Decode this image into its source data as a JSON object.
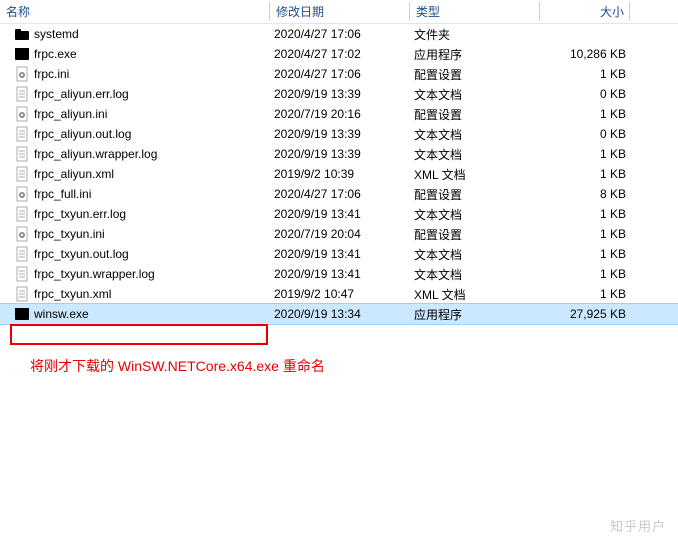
{
  "columns": {
    "name": "名称",
    "date": "修改日期",
    "type": "类型",
    "size": "大小"
  },
  "rows": [
    {
      "icon": "folder",
      "name": "systemd",
      "date": "2020/4/27 17:06",
      "type": "文件夹",
      "size": "",
      "selected": false
    },
    {
      "icon": "exe",
      "name": "frpc.exe",
      "date": "2020/4/27 17:02",
      "type": "应用程序",
      "size": "10,286 KB",
      "selected": false
    },
    {
      "icon": "ini",
      "name": "frpc.ini",
      "date": "2020/4/27 17:06",
      "type": "配置设置",
      "size": "1 KB",
      "selected": false
    },
    {
      "icon": "txt",
      "name": "frpc_aliyun.err.log",
      "date": "2020/9/19 13:39",
      "type": "文本文档",
      "size": "0 KB",
      "selected": false
    },
    {
      "icon": "ini",
      "name": "frpc_aliyun.ini",
      "date": "2020/7/19 20:16",
      "type": "配置设置",
      "size": "1 KB",
      "selected": false
    },
    {
      "icon": "txt",
      "name": "frpc_aliyun.out.log",
      "date": "2020/9/19 13:39",
      "type": "文本文档",
      "size": "0 KB",
      "selected": false
    },
    {
      "icon": "txt",
      "name": "frpc_aliyun.wrapper.log",
      "date": "2020/9/19 13:39",
      "type": "文本文档",
      "size": "1 KB",
      "selected": false
    },
    {
      "icon": "xml",
      "name": "frpc_aliyun.xml",
      "date": "2019/9/2 10:39",
      "type": "XML 文档",
      "size": "1 KB",
      "selected": false
    },
    {
      "icon": "ini",
      "name": "frpc_full.ini",
      "date": "2020/4/27 17:06",
      "type": "配置设置",
      "size": "8 KB",
      "selected": false
    },
    {
      "icon": "txt",
      "name": "frpc_txyun.err.log",
      "date": "2020/9/19 13:41",
      "type": "文本文档",
      "size": "1 KB",
      "selected": false
    },
    {
      "icon": "ini",
      "name": "frpc_txyun.ini",
      "date": "2020/7/19 20:04",
      "type": "配置设置",
      "size": "1 KB",
      "selected": false
    },
    {
      "icon": "txt",
      "name": "frpc_txyun.out.log",
      "date": "2020/9/19 13:41",
      "type": "文本文档",
      "size": "1 KB",
      "selected": false
    },
    {
      "icon": "txt",
      "name": "frpc_txyun.wrapper.log",
      "date": "2020/9/19 13:41",
      "type": "文本文档",
      "size": "1 KB",
      "selected": false
    },
    {
      "icon": "xml",
      "name": "frpc_txyun.xml",
      "date": "2019/9/2 10:47",
      "type": "XML 文档",
      "size": "1 KB",
      "selected": false
    },
    {
      "icon": "exe",
      "name": "winsw.exe",
      "date": "2020/9/19 13:34",
      "type": "应用程序",
      "size": "27,925 KB",
      "selected": true
    }
  ],
  "annotation": "将刚才下载的 WinSW.NETCore.x64.exe 重命名",
  "watermark": "知乎用户"
}
